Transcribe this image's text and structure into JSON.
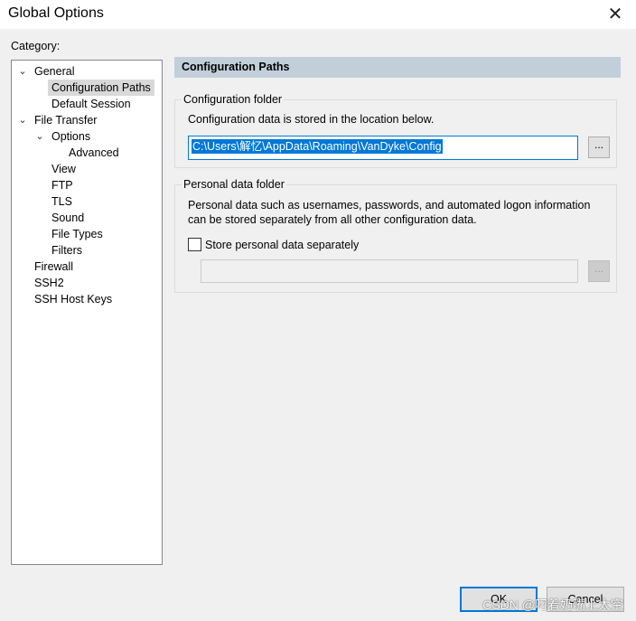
{
  "window": {
    "title": "Global Options",
    "close_icon": "close-icon",
    "close_glyph": "✕"
  },
  "category_label": "Category:",
  "tree": [
    {
      "label": "General",
      "expanded": true,
      "level": 0
    },
    {
      "label": "Configuration Paths",
      "level": 1,
      "selected": true
    },
    {
      "label": "Default Session",
      "level": 1
    },
    {
      "label": "File Transfer",
      "expanded": true,
      "level": 0
    },
    {
      "label": "Options",
      "expanded": true,
      "level": 1
    },
    {
      "label": "Advanced",
      "level": 2
    },
    {
      "label": "View",
      "level": 1
    },
    {
      "label": "FTP",
      "level": 1
    },
    {
      "label": "TLS",
      "level": 1
    },
    {
      "label": "Sound",
      "level": 1
    },
    {
      "label": "File Types",
      "level": 1
    },
    {
      "label": "Filters",
      "level": 1
    },
    {
      "label": "Firewall",
      "level": 0
    },
    {
      "label": "SSH2",
      "level": 0
    },
    {
      "label": "SSH Host Keys",
      "level": 0
    }
  ],
  "panel": {
    "header": "Configuration Paths",
    "config_folder": {
      "legend": "Configuration folder",
      "description": "Configuration data is stored in the location below.",
      "path_value": "C:\\Users\\解忆\\AppData\\Roaming\\VanDyke\\Config",
      "browse_label": "..."
    },
    "personal_folder": {
      "legend": "Personal data folder",
      "description_line1": "Personal data such as usernames, passwords, and automated logon information",
      "description_line2": "can be stored separately from all other configuration data.",
      "checkbox_label": "Store personal data separately",
      "checkbox_checked": false,
      "path_value": "",
      "browse_label": "..."
    }
  },
  "buttons": {
    "ok": "OK",
    "cancel": "Cancel"
  },
  "watermark": "CSDN @叼着奶嘴上太空",
  "colors": {
    "accent": "#0078d7",
    "header_bg": "#c2cfdb"
  }
}
